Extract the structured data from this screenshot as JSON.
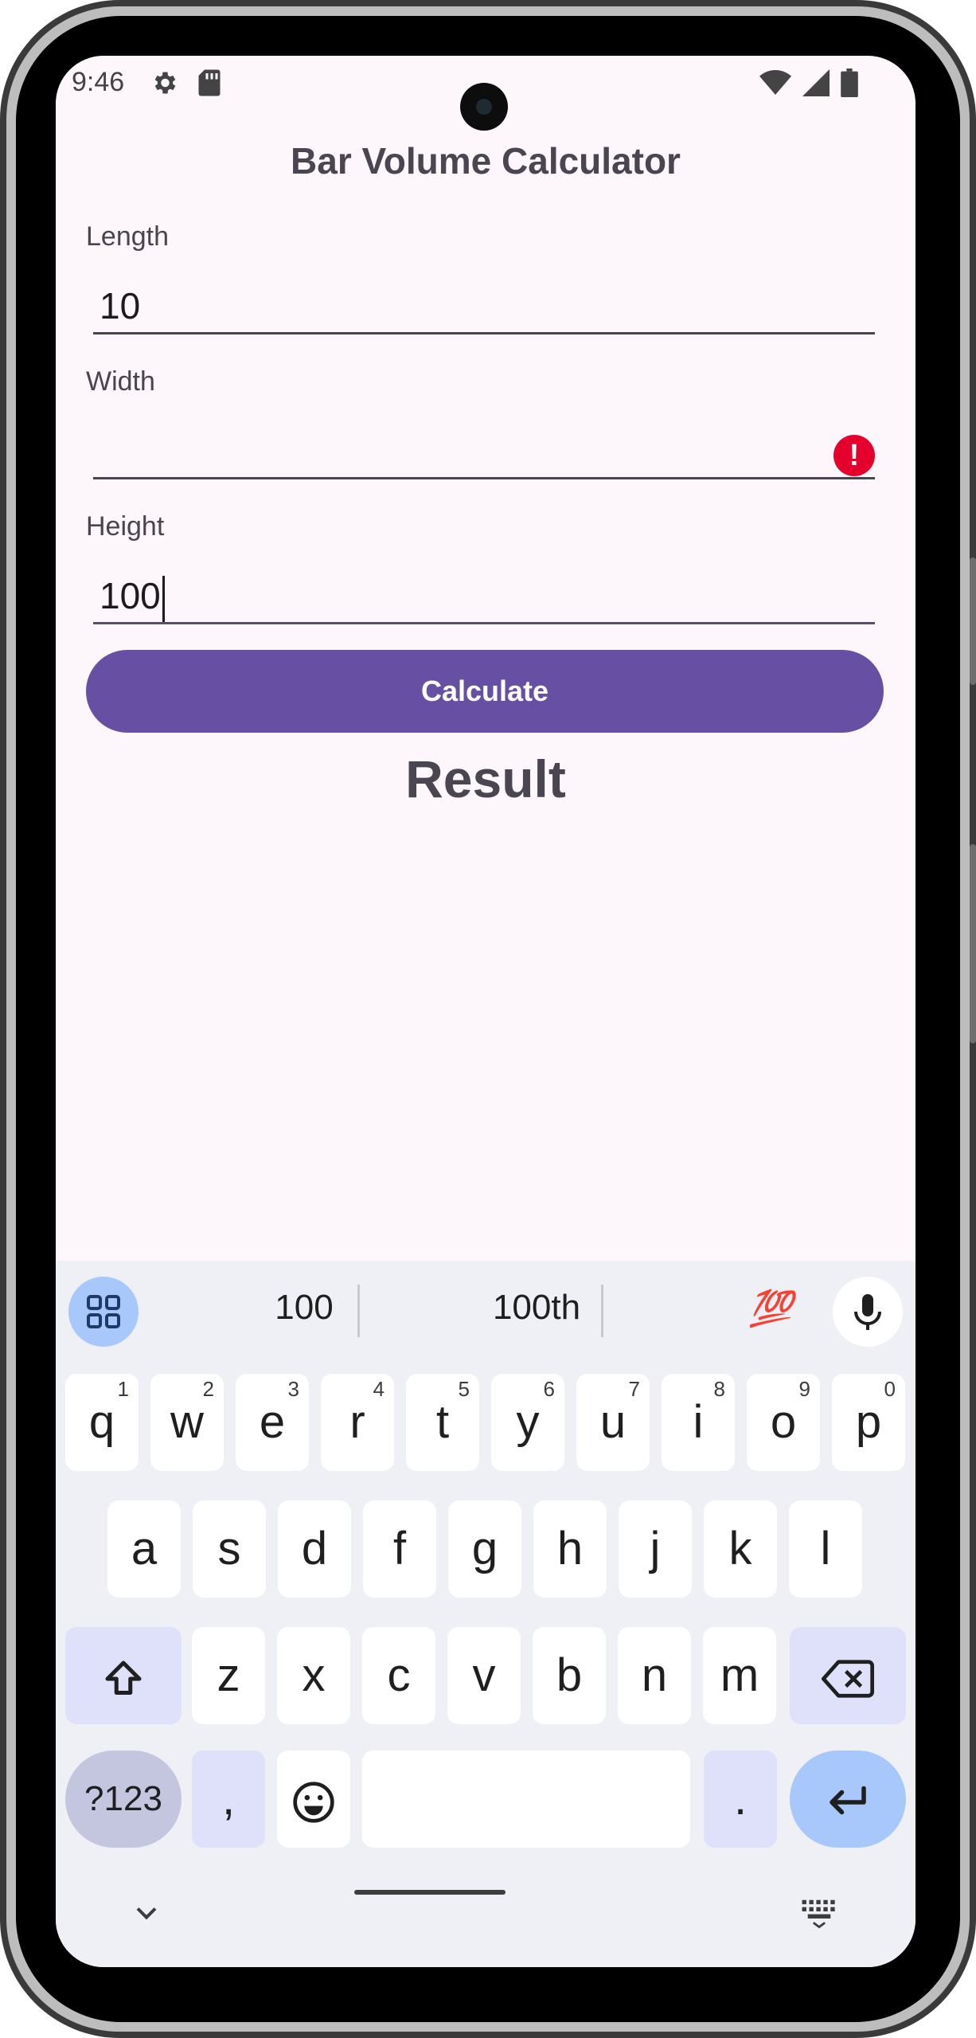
{
  "status": {
    "time": "9:46",
    "left_icons": [
      "gear-icon",
      "sd-card-icon"
    ],
    "right_icons": [
      "wifi-icon",
      "signal-icon",
      "battery-icon"
    ]
  },
  "app": {
    "title": "Bar Volume Calculator",
    "fields": [
      {
        "label": "Length",
        "value": "10",
        "error": false
      },
      {
        "label": "Width",
        "value": "",
        "error": true
      },
      {
        "label": "Height",
        "value": "100",
        "error": false,
        "focused": true
      }
    ],
    "calculate_label": "Calculate",
    "result_label": "Result"
  },
  "keyboard": {
    "suggestions": [
      "100",
      "100th",
      "💯"
    ],
    "row1": [
      {
        "k": "q",
        "s": "1"
      },
      {
        "k": "w",
        "s": "2"
      },
      {
        "k": "e",
        "s": "3"
      },
      {
        "k": "r",
        "s": "4"
      },
      {
        "k": "t",
        "s": "5"
      },
      {
        "k": "y",
        "s": "6"
      },
      {
        "k": "u",
        "s": "7"
      },
      {
        "k": "i",
        "s": "8"
      },
      {
        "k": "o",
        "s": "9"
      },
      {
        "k": "p",
        "s": "0"
      }
    ],
    "row2": [
      "a",
      "s",
      "d",
      "f",
      "g",
      "h",
      "j",
      "k",
      "l"
    ],
    "row3": [
      "z",
      "x",
      "c",
      "v",
      "b",
      "n",
      "m"
    ],
    "sym_label": "?123",
    "comma_label": ",",
    "period_label": ".",
    "colors": {
      "accent": "#6750a4",
      "error": "#e5002e",
      "key_mod": "#dfe1fa",
      "key_blue": "#a8c7fa"
    }
  }
}
